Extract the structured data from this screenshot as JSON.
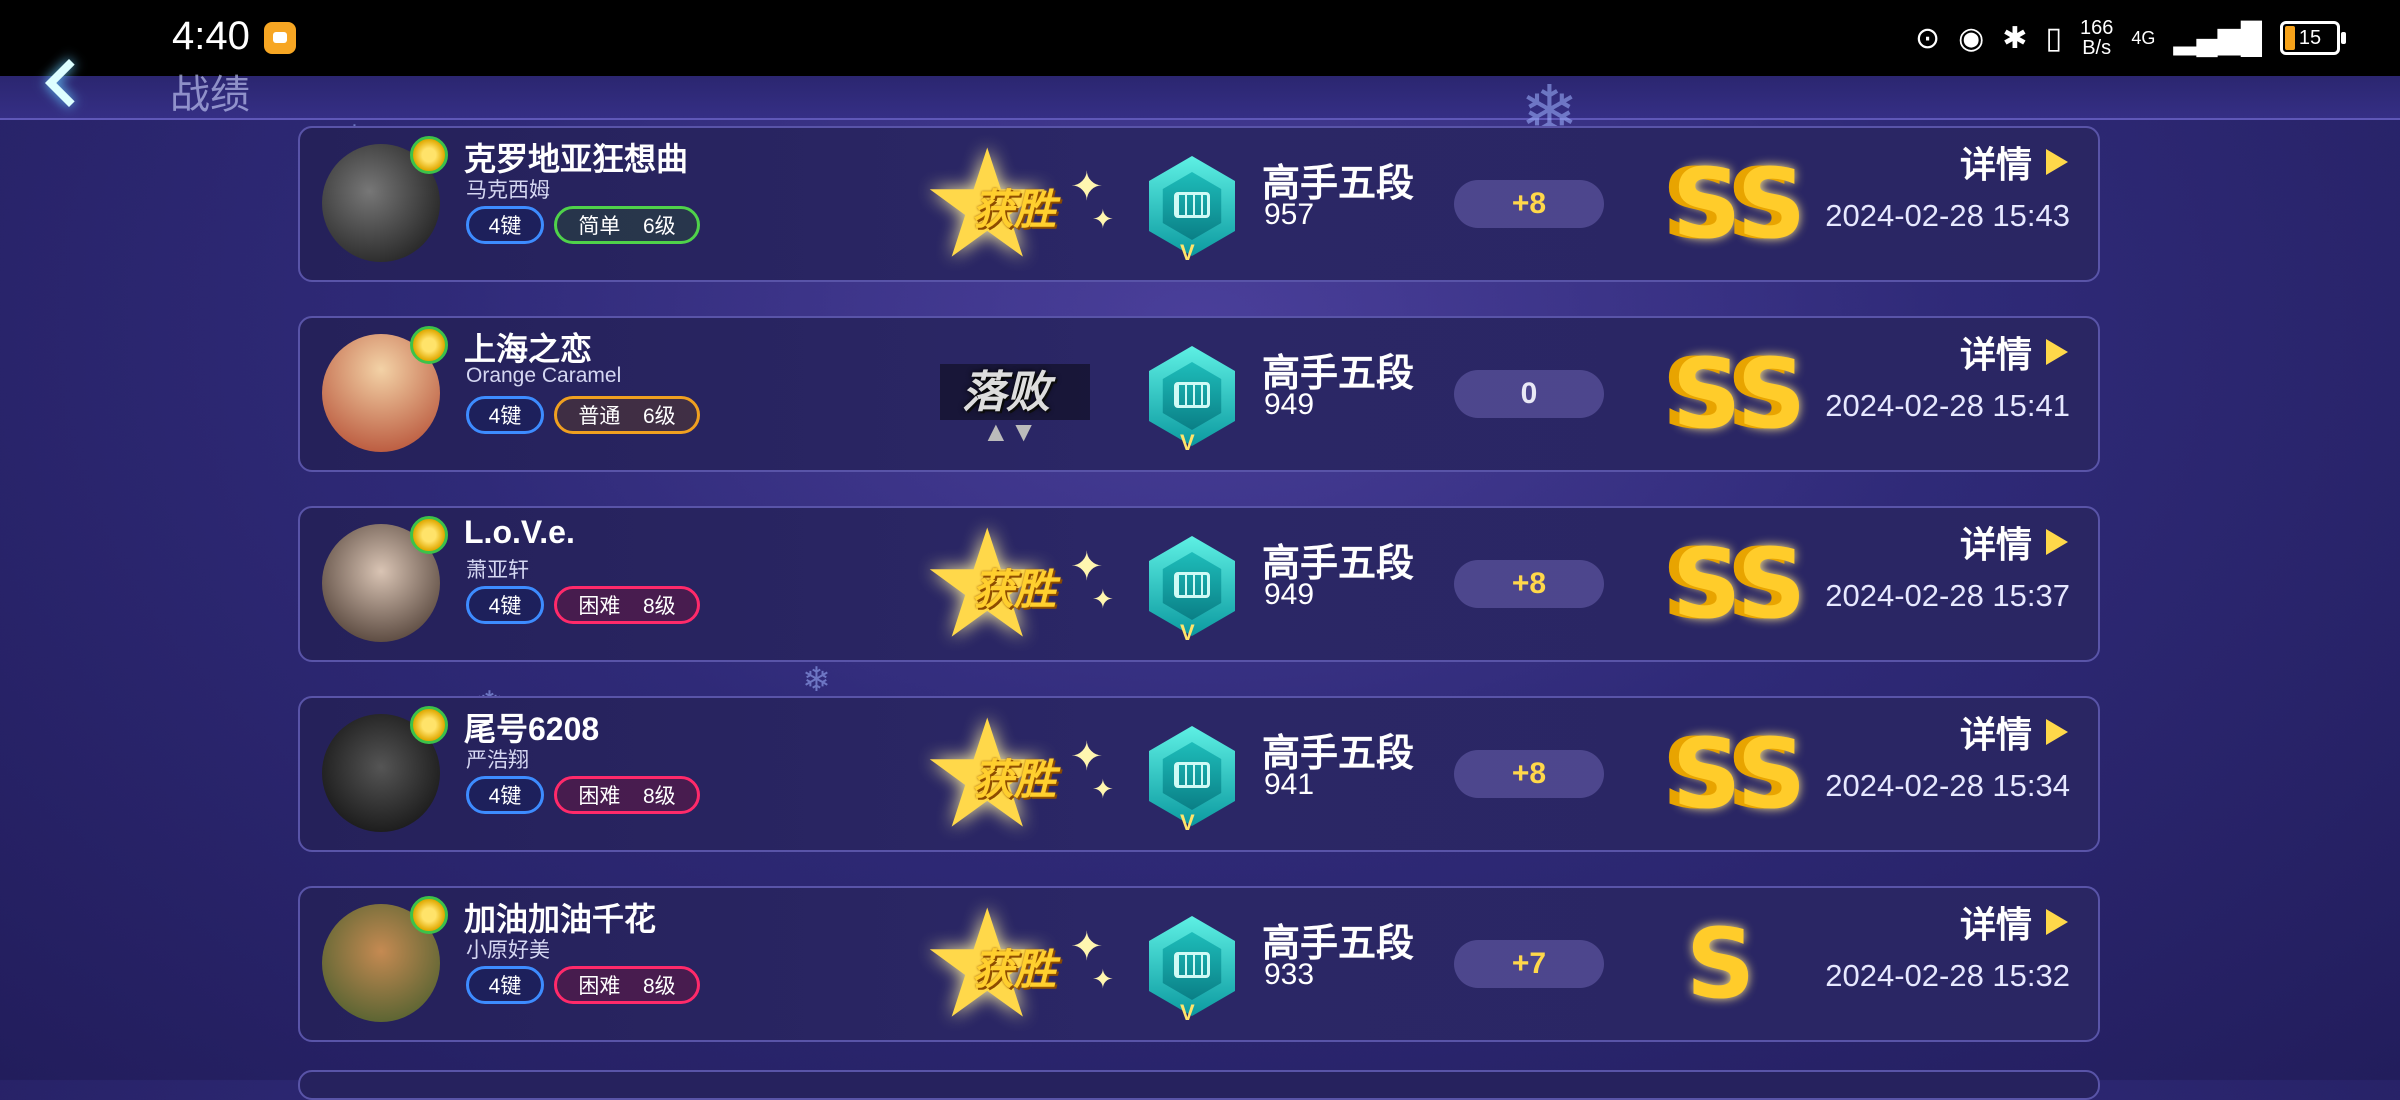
{
  "status_bar": {
    "time": "4:40",
    "net_speed_top": "166",
    "net_speed_bottom": "B/s",
    "network": "4G",
    "battery": "15"
  },
  "header": {
    "title": "战绩"
  },
  "records": [
    {
      "title": "克罗地亚狂想曲",
      "artist": "马克西姆",
      "keys": "4键",
      "difficulty": "简单",
      "level": "6级",
      "result": "获胜",
      "rank_name": "高手五段",
      "rank_score": "957",
      "delta": "+8",
      "grade": "SS",
      "detail": "详情",
      "date": "2024-02-28 15:43"
    },
    {
      "title": "上海之恋",
      "artist": "Orange Caramel",
      "keys": "4键",
      "difficulty": "普通",
      "level": "6级",
      "result": "落败",
      "rank_name": "高手五段",
      "rank_score": "949",
      "delta": "0",
      "grade": "SS",
      "detail": "详情",
      "date": "2024-02-28 15:41"
    },
    {
      "title": "L.o.V.e.",
      "artist": "萧亚轩",
      "keys": "4键",
      "difficulty": "困难",
      "level": "8级",
      "result": "获胜",
      "rank_name": "高手五段",
      "rank_score": "949",
      "delta": "+8",
      "grade": "SS",
      "detail": "详情",
      "date": "2024-02-28 15:37"
    },
    {
      "title": "尾号6208",
      "artist": "严浩翔",
      "keys": "4键",
      "difficulty": "困难",
      "level": "8级",
      "result": "获胜",
      "rank_name": "高手五段",
      "rank_score": "941",
      "delta": "+8",
      "grade": "SS",
      "detail": "详情",
      "date": "2024-02-28 15:34"
    },
    {
      "title": "加油加油千花",
      "artist": "小原好美",
      "keys": "4键",
      "difficulty": "困难",
      "level": "8级",
      "result": "获胜",
      "rank_name": "高手五段",
      "rank_score": "933",
      "delta": "+7",
      "grade": "S",
      "detail": "详情",
      "date": "2024-02-28 15:32"
    }
  ],
  "colors": {
    "easy": "#4fd24a",
    "normal": "#f0a020",
    "hard": "#ff2a6a",
    "key_tag": "#3d8cff"
  }
}
